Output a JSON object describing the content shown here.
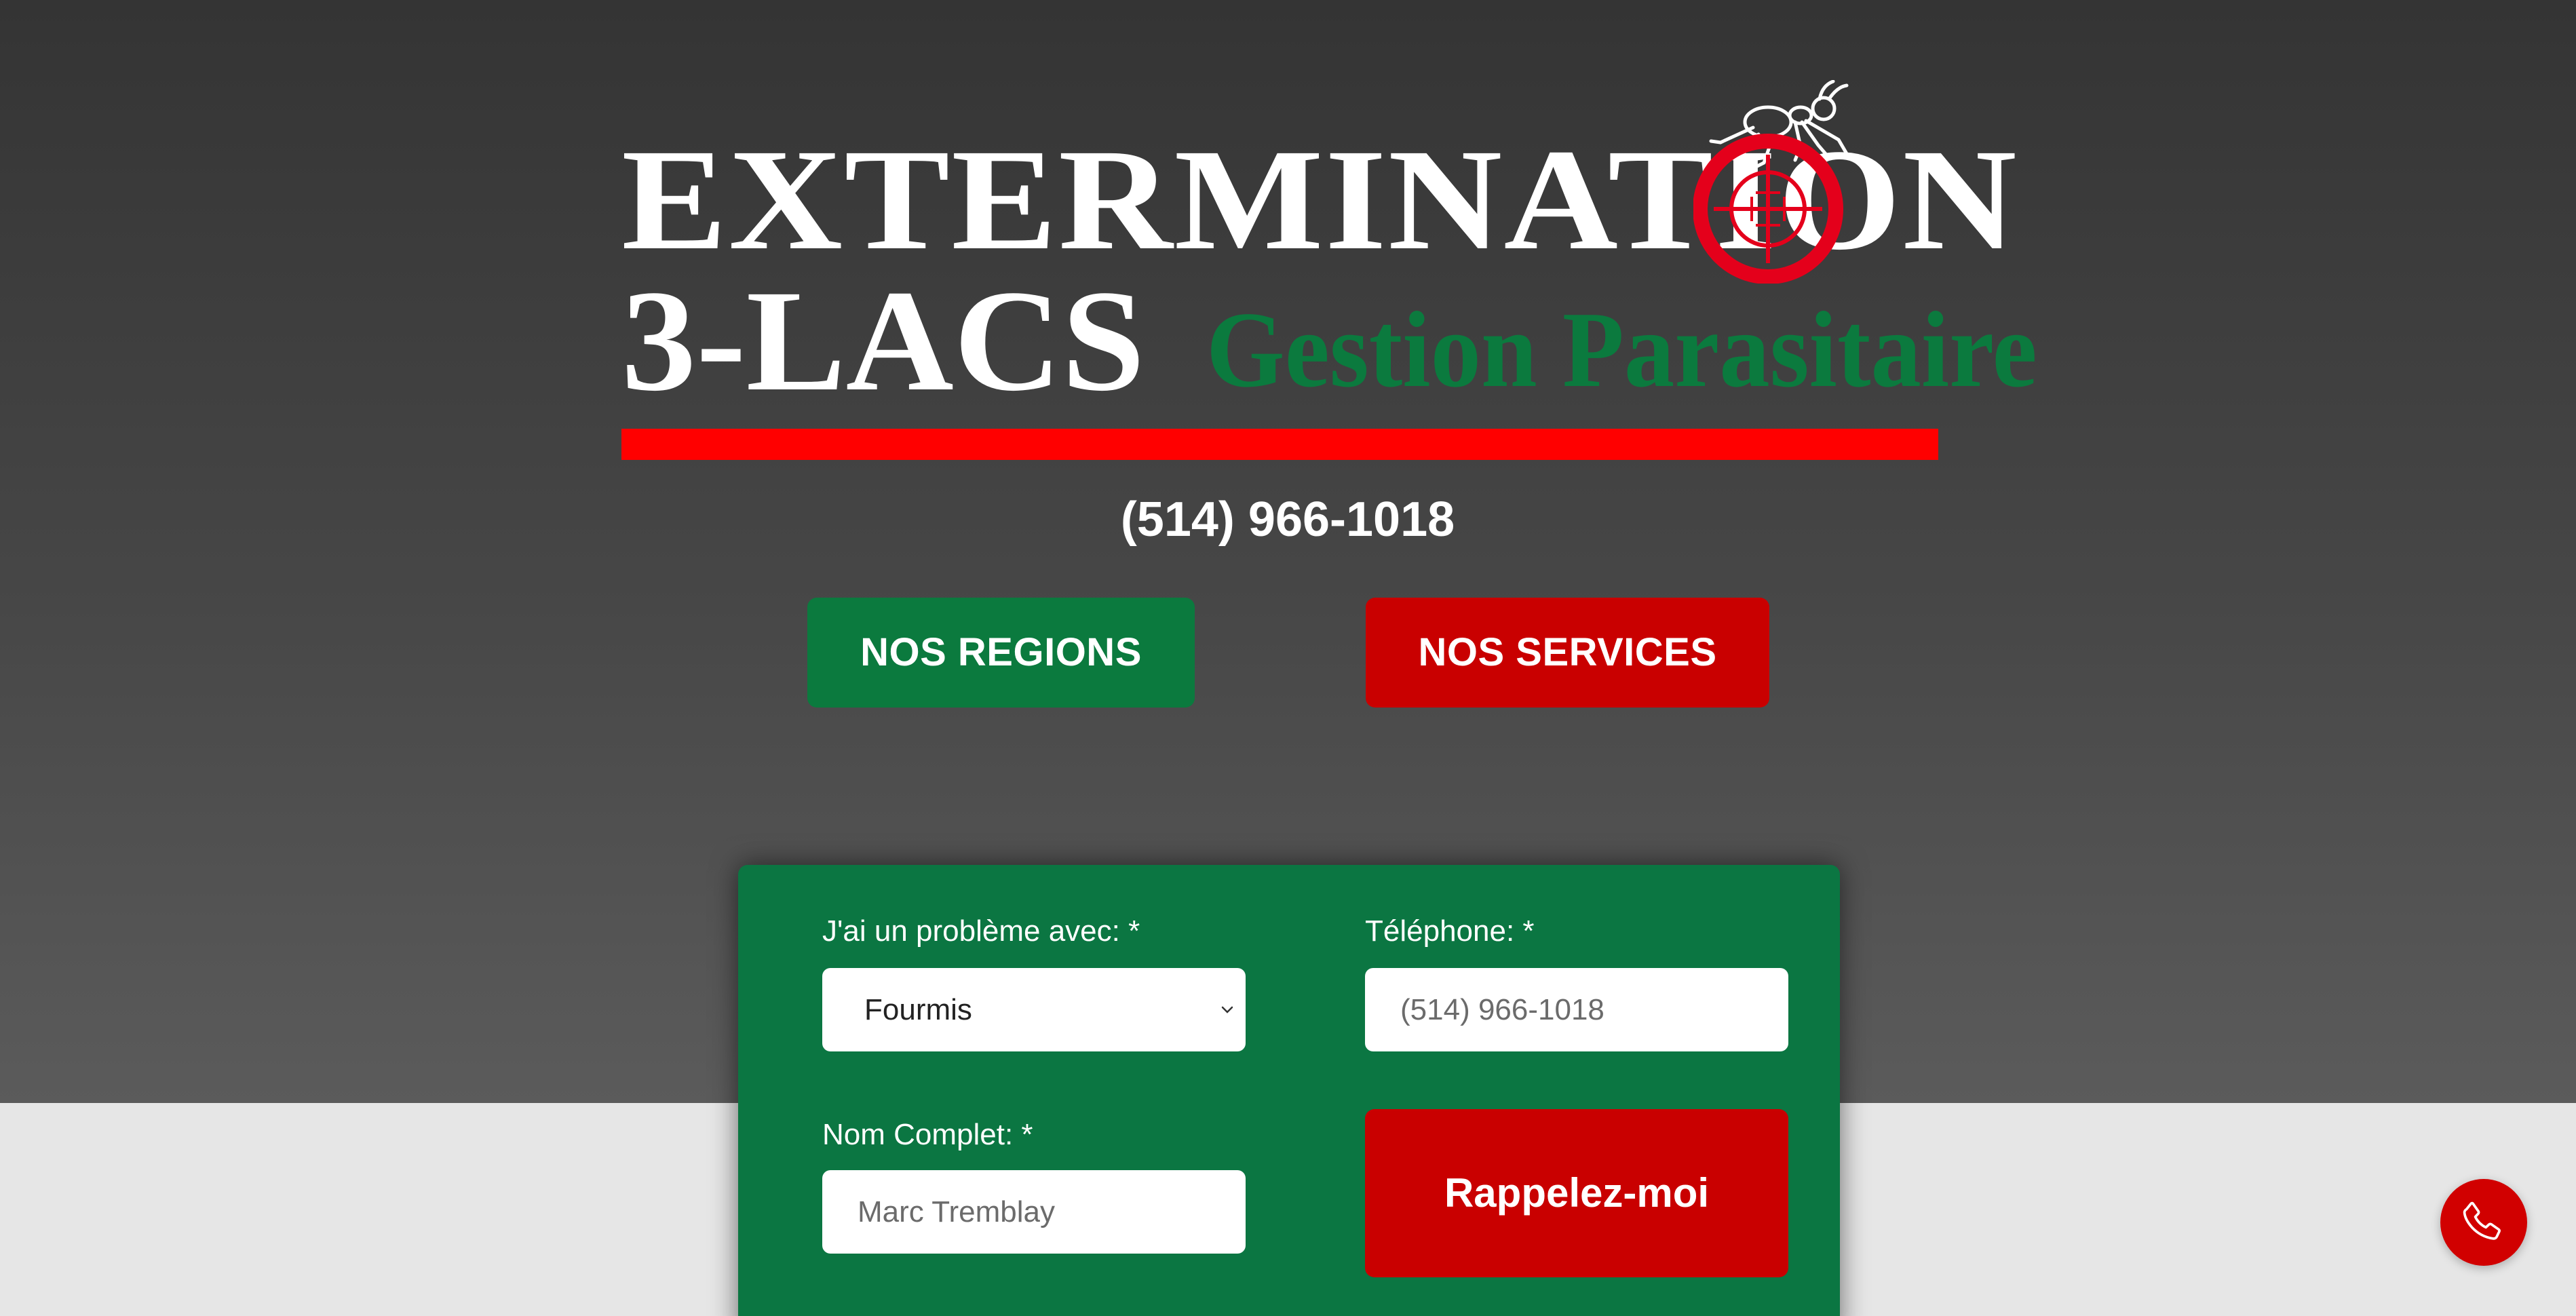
{
  "logo": {
    "line1": "EXTERMINATION",
    "line2": "3-LACS",
    "tagline": "Gestion Parasitaire",
    "icon": "ant-crosshair-icon"
  },
  "phone": "(514) 966-1018",
  "buttons": {
    "regions": "NOS REGIONS",
    "services": "NOS SERVICES"
  },
  "form": {
    "problem_label": "J'ai un problème avec: *",
    "problem_value": "Fourmis",
    "phone_label": "Téléphone: *",
    "phone_placeholder": "(514) 966-1018",
    "name_label": "Nom Complet: *",
    "name_placeholder": "Marc Tremblay",
    "submit_label": "Rappelez-moi"
  },
  "fab": {
    "icon": "phone-icon"
  },
  "colors": {
    "hero_top": "#343434",
    "hero_bottom": "#5b5b5b",
    "green": "#0b7642",
    "red": "#c90000",
    "logo_bar": "#ff0000",
    "page_bg": "#e6e6e6"
  }
}
